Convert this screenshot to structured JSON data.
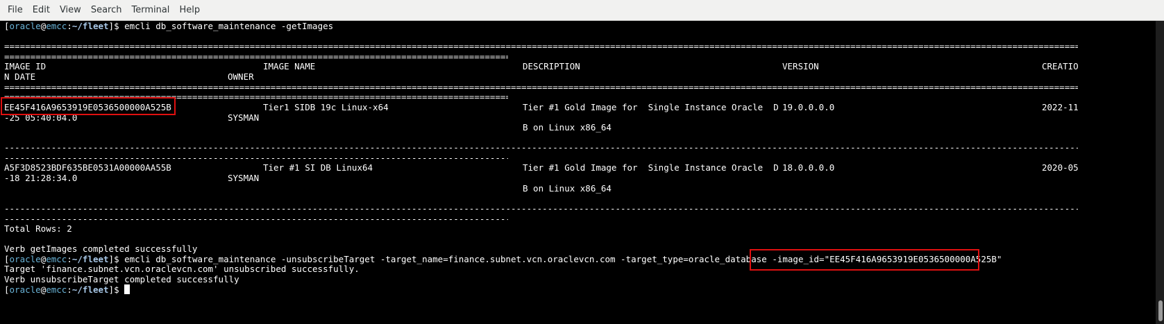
{
  "menubar": {
    "items": [
      "File",
      "Edit",
      "View",
      "Search",
      "Terminal",
      "Help"
    ]
  },
  "prompt": {
    "user": "oracle",
    "at": "@",
    "host": "emcc",
    "colon": ":",
    "path": "~/fleet",
    "end": "]$ "
  },
  "command1": "emcli db_software_maintenance -getImages",
  "rule_eq": "==================================================================================================================================================================================================================================================================================================================================================",
  "rule_dash": "------------------------------------------------------------------------------------------------------------------------------------------------------------------------------------------------------------------------------------------------------------------------------------------------------------------------------------------------",
  "table": {
    "headers": {
      "image_id": "IMAGE ID",
      "image_name": "IMAGE NAME",
      "description": "DESCRIPTION",
      "version": "VERSION",
      "creation_part1": "CREATIO",
      "creation_part2": "N DATE",
      "owner": "OWNER"
    },
    "rows": [
      {
        "image_id": "EE45F416A9653919E0536500000A525B",
        "image_name": "Tier1 SIDB 19c Linux-x64",
        "description_line1": "Tier #1 Gold Image for  Single Instance Oracle  D",
        "description_line2": "B on Linux x86_64",
        "version": "19.0.0.0.0",
        "creation_part1": "2022-11",
        "creation_part2": "-25 05:40:04.0",
        "owner": "SYSMAN"
      },
      {
        "image_id": "A5F3D8523BDF635BE0531A00000AA55B",
        "image_name": "Tier #1 SI DB Linux64",
        "description_line1": "Tier #1 Gold Image for  Single Instance Oracle  D",
        "description_line2": "B on Linux x86_64",
        "version": "18.0.0.0.0",
        "creation_part1": "2020-05",
        "creation_part2": "-18 21:28:34.0",
        "owner": "SYSMAN"
      }
    ]
  },
  "total_rows": "Total Rows: 2",
  "verb1": "Verb getImages completed successfully",
  "command2_main": "emcli db_software_maintenance -unsubscribeTarget -target_name=finance.subnet.vcn.oraclevcn.com -target_type=oracle_database ",
  "command2_image_arg": "-image_id=\"EE45F416A9653919E0536500000A525B\"",
  "target_msg": "Target 'finance.subnet.vcn.oraclevcn.com' unsubscribed successfully.",
  "verb2": "Verb unsubscribeTarget completed successfully"
}
